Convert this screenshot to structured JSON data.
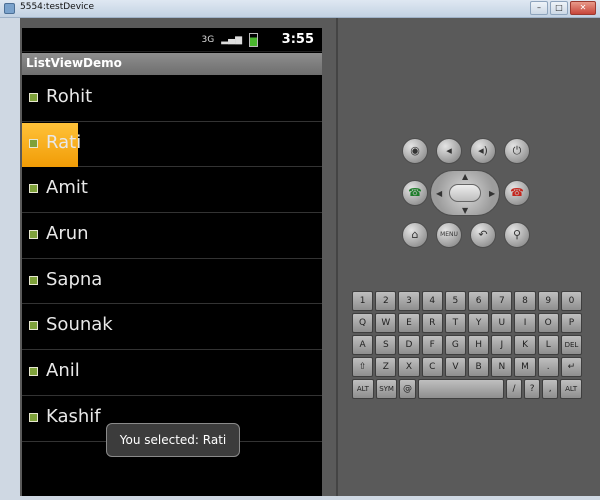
{
  "window": {
    "title": "5554:testDevice",
    "min": "–",
    "max": "□",
    "close": "✕"
  },
  "status": {
    "net": "3G",
    "time": "3:55"
  },
  "app": {
    "title": "ListViewDemo"
  },
  "list": [
    {
      "name": "Rohit"
    },
    {
      "name": "Rati"
    },
    {
      "name": "Amit"
    },
    {
      "name": "Arun"
    },
    {
      "name": "Sapna"
    },
    {
      "name": "Sounak"
    },
    {
      "name": "Anil"
    },
    {
      "name": "Kashif"
    }
  ],
  "toast": {
    "text": "You selected: Rati"
  },
  "controls": {
    "camera": "camera-icon",
    "vol_down": "volume-down-icon",
    "vol_up": "volume-up-icon",
    "power": "power-icon",
    "call": "call-icon",
    "end_call": "end-call-icon",
    "home": "home-icon",
    "menu_label": "MENU",
    "back": "back-icon",
    "search": "search-icon"
  },
  "keyboard": {
    "row1": [
      "1",
      "2",
      "3",
      "4",
      "5",
      "6",
      "7",
      "8",
      "9",
      "0"
    ],
    "row2": [
      "Q",
      "W",
      "E",
      "R",
      "T",
      "Y",
      "U",
      "I",
      "O",
      "P"
    ],
    "row3": [
      "A",
      "S",
      "D",
      "F",
      "G",
      "H",
      "J",
      "K",
      "L",
      "DEL"
    ],
    "row4": [
      "⇧",
      "Z",
      "X",
      "C",
      "V",
      "B",
      "N",
      "M",
      ".",
      "↵"
    ],
    "row5": [
      "ALT",
      "SYM",
      "@",
      "",
      "/",
      "?",
      ",",
      "ALT"
    ]
  }
}
